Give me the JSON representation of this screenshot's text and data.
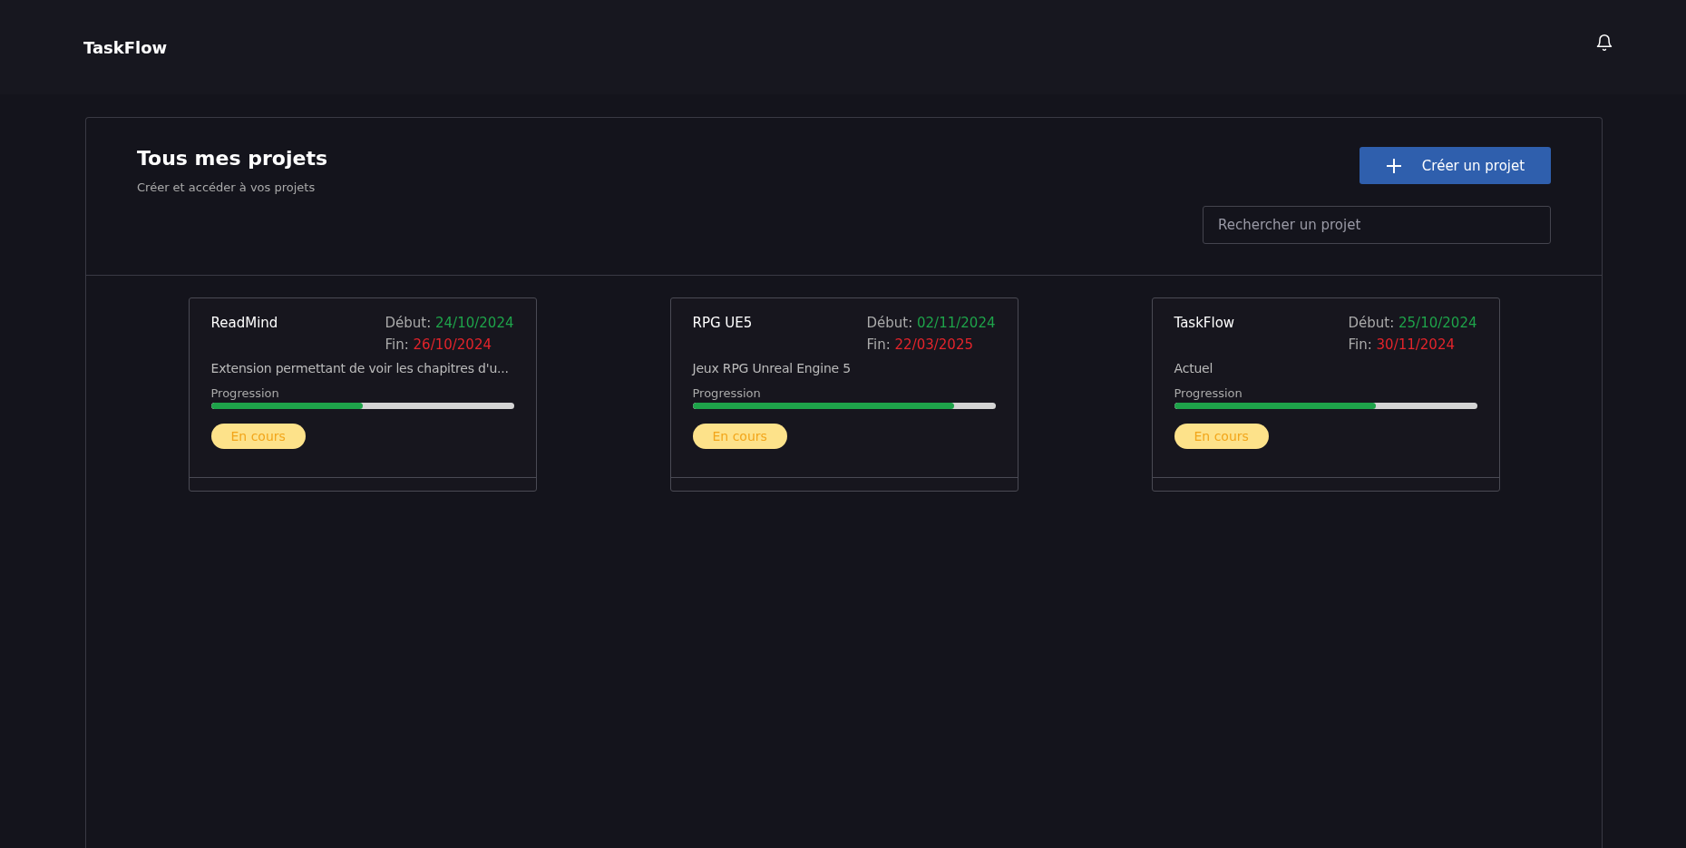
{
  "header": {
    "logo": "TaskFlow"
  },
  "page": {
    "title": "Tous mes projets",
    "subtitle": "Créer et accéder à vos projets",
    "create_button": "Créer un projet",
    "search": {
      "placeholder": "Rechercher un projet"
    }
  },
  "projects": [
    {
      "name": "ReadMind",
      "start_label": "Début:",
      "start": "24/10/2024",
      "end_label": "Fin:",
      "end": "26/10/2024",
      "description": "Extension permettant de voir les chapitres d'u...",
      "progress_label": "Progression",
      "level": 0.5,
      "status": {
        "kind": "in_progress",
        "label": "En cours"
      }
    },
    {
      "name": "RPG UE5",
      "start_label": "Début:",
      "start": "02/11/2024",
      "end_label": "Fin:",
      "end": "22/03/2025",
      "description": "Jeux RPG Unreal Engine 5",
      "progress_label": "Progression",
      "level": 0.865,
      "status": {
        "kind": "in_progress",
        "label": "En cours"
      }
    },
    {
      "name": "TaskFlow",
      "start_label": "Début:",
      "start": "25/10/2024",
      "end_label": "Fin:",
      "end": "30/11/2024",
      "description": "Actuel",
      "progress_label": "Progression",
      "level": 0.665,
      "status": {
        "kind": "in_progress",
        "label": "En cours"
      }
    }
  ]
}
